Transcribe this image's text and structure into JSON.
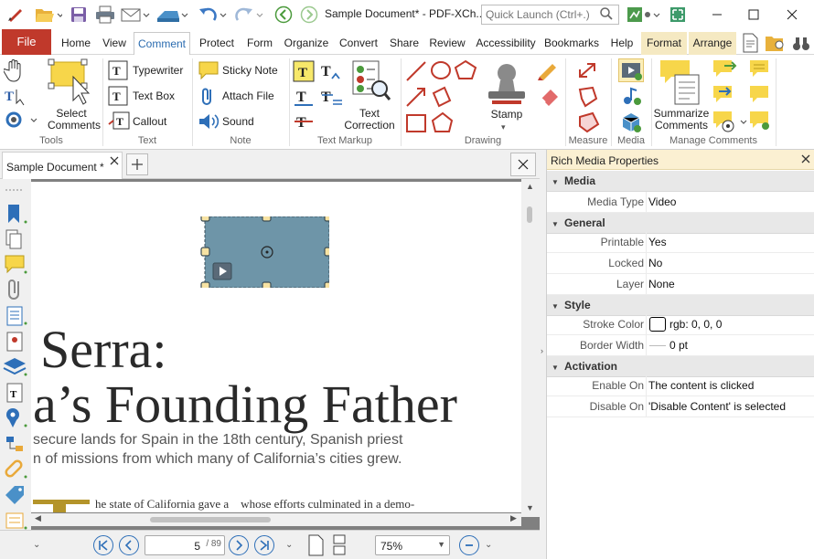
{
  "window": {
    "title": "Sample Document* - PDF-XCh..",
    "quick_launch_placeholder": "Quick Launch (Ctrl+.)"
  },
  "menu": {
    "file": "File",
    "tabs": [
      "Home",
      "View",
      "Comment",
      "Protect",
      "Form",
      "Organize",
      "Convert",
      "Share",
      "Review",
      "Accessibility",
      "Bookmarks",
      "Help"
    ],
    "context_tabs": [
      "Format",
      "Arrange"
    ]
  },
  "ribbon": {
    "tools": {
      "select_comments_l1": "Select",
      "select_comments_l2": "Comments",
      "label": "Tools"
    },
    "text": {
      "typewriter": "Typewriter",
      "text_box": "Text Box",
      "callout": "Callout",
      "label": "Text"
    },
    "note": {
      "sticky_note": "Sticky Note",
      "attach_file": "Attach File",
      "sound": "Sound",
      "label": "Note"
    },
    "text_markup": {
      "correction_l1": "Text",
      "correction_l2": "Correction",
      "label": "Text Markup"
    },
    "drawing": {
      "stamp": "Stamp",
      "label": "Drawing"
    },
    "measure": {
      "label": "Measure"
    },
    "media": {
      "label": "Media"
    },
    "manage": {
      "summarize_l1": "Summarize",
      "summarize_l2": "Comments",
      "label": "Manage Comments"
    }
  },
  "document": {
    "tab_title": "Sample Document *",
    "heading_line1": "Serra:",
    "heading_line2": "a’s Founding Father",
    "sub_line1": "secure lands for Spain in the 18th century, Spanish priest",
    "sub_line2": "n of missions from which many of California’s cities grew.",
    "body_line": "he state of California gave a    whose efforts culminated in a demo-"
  },
  "status": {
    "page_current": "5",
    "page_total": "/ 89",
    "zoom": "75%"
  },
  "properties": {
    "title": "Rich Media Properties",
    "sections": {
      "media": "Media",
      "general": "General",
      "style": "Style",
      "activation": "Activation"
    },
    "media_type": {
      "key": "Media Type",
      "value": "Video"
    },
    "printable": {
      "key": "Printable",
      "value": "Yes"
    },
    "locked": {
      "key": "Locked",
      "value": "No"
    },
    "layer": {
      "key": "Layer",
      "value": "None"
    },
    "stroke_color": {
      "key": "Stroke Color",
      "value": "rgb: 0, 0, 0",
      "swatch": "#000000"
    },
    "border_width": {
      "key": "Border Width",
      "value": "0 pt"
    },
    "enable_on": {
      "key": "Enable On",
      "value": "The content is clicked"
    },
    "disable_on": {
      "key": "Disable On",
      "value": "'Disable Content' is selected"
    }
  },
  "colors": {
    "file_tab": "#c0392b",
    "active_tab_border": "#2b6cb0",
    "media_fill": "#6e95a8",
    "handle_fill": "#f7e3a3",
    "context_tab_bg": "#f5e9c2",
    "panel_title_bg": "#fbf0d2",
    "drop_cap": "#b4942a"
  },
  "icons": [
    "app-logo-icon",
    "folder-open-icon",
    "save-icon",
    "print-icon",
    "email-icon",
    "scan-icon",
    "undo-icon",
    "redo-icon",
    "back-icon",
    "forward-icon",
    "search-icon",
    "settings-icon",
    "fullscreen-icon",
    "minimize-icon",
    "maximize-icon",
    "close-icon",
    "play-icon"
  ]
}
